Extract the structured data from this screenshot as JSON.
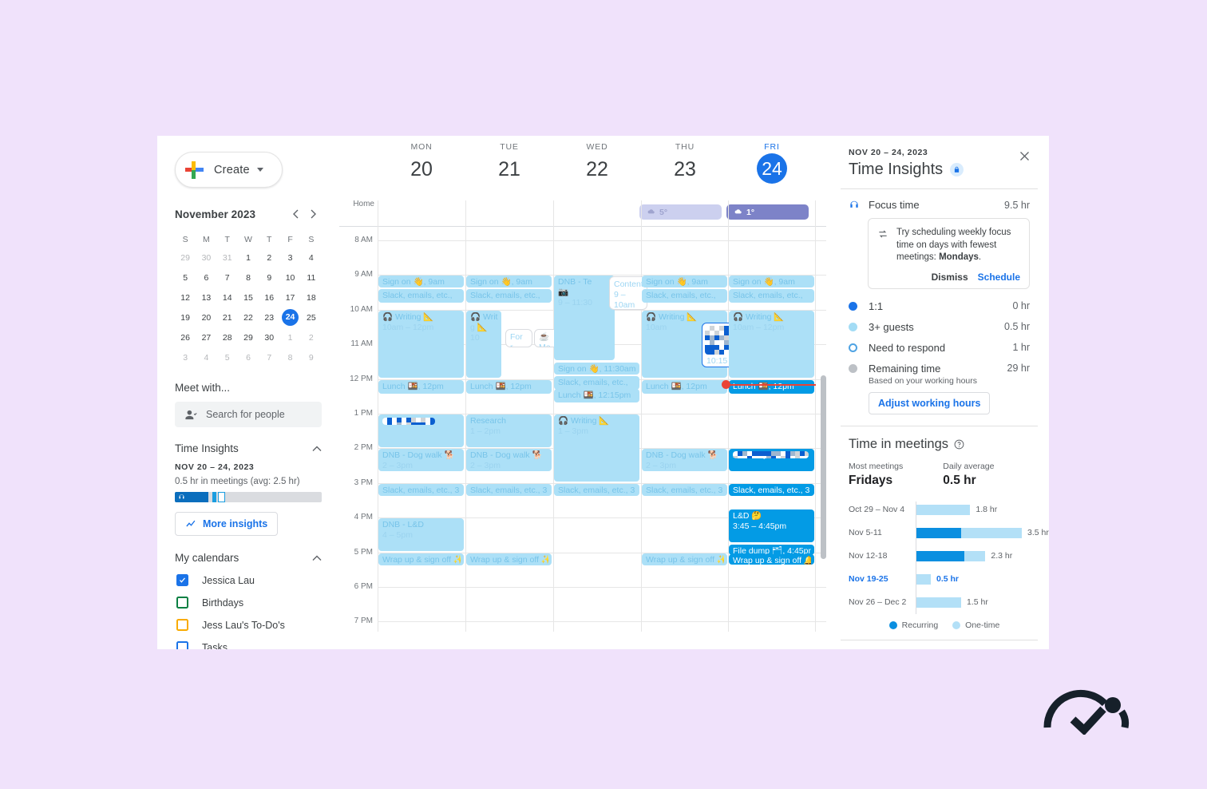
{
  "sidebar": {
    "create_label": "Create",
    "mini_calendar": {
      "title": "November 2023",
      "weekdays": [
        "S",
        "M",
        "T",
        "W",
        "T",
        "F",
        "S"
      ],
      "weeks": [
        [
          {
            "d": "29",
            "m": true
          },
          {
            "d": "30",
            "m": true
          },
          {
            "d": "31",
            "m": true
          },
          {
            "d": "1"
          },
          {
            "d": "2"
          },
          {
            "d": "3"
          },
          {
            "d": "4"
          }
        ],
        [
          {
            "d": "5"
          },
          {
            "d": "6"
          },
          {
            "d": "7"
          },
          {
            "d": "8"
          },
          {
            "d": "9"
          },
          {
            "d": "10"
          },
          {
            "d": "11"
          }
        ],
        [
          {
            "d": "12"
          },
          {
            "d": "13"
          },
          {
            "d": "14"
          },
          {
            "d": "15"
          },
          {
            "d": "16"
          },
          {
            "d": "17"
          },
          {
            "d": "18"
          }
        ],
        [
          {
            "d": "19"
          },
          {
            "d": "20"
          },
          {
            "d": "21"
          },
          {
            "d": "22"
          },
          {
            "d": "23"
          },
          {
            "d": "24",
            "sel": true
          },
          {
            "d": "25"
          }
        ],
        [
          {
            "d": "26"
          },
          {
            "d": "27"
          },
          {
            "d": "28"
          },
          {
            "d": "29"
          },
          {
            "d": "30"
          },
          {
            "d": "1",
            "m": true
          },
          {
            "d": "2",
            "m": true
          }
        ],
        [
          {
            "d": "3",
            "m": true
          },
          {
            "d": "4",
            "m": true
          },
          {
            "d": "5",
            "m": true
          },
          {
            "d": "6",
            "m": true
          },
          {
            "d": "7",
            "m": true
          },
          {
            "d": "8",
            "m": true
          },
          {
            "d": "9",
            "m": true
          }
        ]
      ]
    },
    "meet_with_label": "Meet with...",
    "search_placeholder": "Search for people",
    "time_insights": {
      "heading": "Time Insights",
      "range": "NOV 20 – 24, 2023",
      "summary": "0.5 hr in meetings (avg: 2.5 hr)",
      "more_button": "More insights"
    },
    "my_calendars": {
      "heading": "My calendars",
      "items": [
        {
          "label": "Jessica Lau",
          "checked": true,
          "color": "#1a73e8"
        },
        {
          "label": "Birthdays",
          "checked": false,
          "color": "#0b8043"
        },
        {
          "label": "Jess Lau's To-Do's",
          "checked": false,
          "color": "#f9ab00"
        },
        {
          "label": "Tasks",
          "checked": false,
          "color": "#1a73e8"
        }
      ]
    }
  },
  "calendar": {
    "gutter_top_label": "Home",
    "days": [
      {
        "dow": "MON",
        "num": "20",
        "today": false
      },
      {
        "dow": "TUE",
        "num": "21",
        "today": false
      },
      {
        "dow": "WED",
        "num": "22",
        "today": false
      },
      {
        "dow": "THU",
        "num": "23",
        "today": false
      },
      {
        "dow": "FRI",
        "num": "24",
        "today": true
      }
    ],
    "hours": [
      "8 AM",
      "9 AM",
      "10 AM",
      "11 AM",
      "12 PM",
      "1 PM",
      "2 PM",
      "3 PM",
      "4 PM",
      "5 PM",
      "6 PM",
      "7 PM"
    ],
    "weather": [
      {
        "day": "THU",
        "temp": "5°",
        "style": "light"
      },
      {
        "day": "FRI",
        "temp": "1°",
        "style": "solid"
      }
    ],
    "events": {
      "mon": [
        {
          "l1": "Sign on 👋, 9am",
          "l2": ""
        },
        {
          "l1": "Slack, emails, etc.,",
          "l2": ""
        },
        {
          "l1": "🎧 Writing 📐",
          "l2": "10am – 12pm"
        },
        {
          "l1": "Lunch 🍱, 12pm",
          "l2": ""
        },
        {
          "l1": "",
          "l2": "1 – 2pm"
        },
        {
          "l1": "DNB - Dog walk 🐕",
          "l2": "2 – 3pm"
        },
        {
          "l1": "Slack, emails, etc., 3",
          "l2": ""
        },
        {
          "l1": "DNB - L&D",
          "l2": "4 – 5pm"
        },
        {
          "l1": "Wrap up & sign off ✨",
          "l2": ""
        }
      ],
      "tue": [
        {
          "l1": "Sign on 👋, 9am",
          "l2": ""
        },
        {
          "l1": "Slack, emails, etc.,",
          "l2": ""
        },
        {
          "l1": "🎧 Writin",
          "l2": "g 📐",
          "l3": "10"
        },
        {
          "l1": "Lunch 🍱, 12pm",
          "l2": ""
        },
        {
          "l1": "Research",
          "l2": "1 – 2pm"
        },
        {
          "l1": "DNB - Dog walk 🐕",
          "l2": "2 – 3pm"
        },
        {
          "l1": "Slack, emails, etc., 3",
          "l2": ""
        },
        {
          "l1": "Wrap up & sign off ✨",
          "l2": ""
        }
      ],
      "tue_popups": [
        {
          "l1": "For r"
        },
        {
          "l1": "☕ Me"
        }
      ],
      "wed": [
        {
          "l1": "DNB - Te",
          "l2": "📷",
          "l3": "9 – 11:30"
        },
        {
          "l1": "Sign on 👋, 11:30am",
          "l2": ""
        },
        {
          "l1": "Slack, emails, etc.,",
          "l2": ""
        },
        {
          "l1": "Lunch 🍱, 12:15pm",
          "l2": ""
        },
        {
          "l1": "🎧 Writing 📐",
          "l2": "1 – 3pm"
        },
        {
          "l1": "Slack, emails, etc., 3",
          "l2": ""
        }
      ],
      "wed_popups": [
        {
          "l1": "Content",
          "l2": "9 – 10am"
        }
      ],
      "thu": [
        {
          "l1": "Sign on 👋, 9am",
          "l2": ""
        },
        {
          "l1": "Slack, emails, etc.,",
          "l2": ""
        },
        {
          "l1": "🎧 Writing 📐",
          "l2": "10am"
        },
        {
          "l1": "Lunch 🍱, 12pm",
          "l2": ""
        },
        {
          "l1": "DNB - Dog walk 🐕",
          "l2": "2 – 3pm"
        },
        {
          "l1": "Slack, emails, etc., 3",
          "l2": ""
        },
        {
          "l1": "Wrap up & sign off ✨",
          "l2": ""
        }
      ],
      "thu_popups": [
        {
          "l2": "10:15"
        }
      ],
      "fri": [
        {
          "l1": "Sign on 👋, 9am",
          "l2": ""
        },
        {
          "l1": "Slack, emails, etc.,",
          "l2": ""
        },
        {
          "l1": "🎧 Writing 📐",
          "l2": "10am – 12pm"
        },
        {
          "l1": "Lunch 🍱, 12pm",
          "l2": ""
        },
        {
          "l1": "",
          "l2": "2 – 2:45pm"
        },
        {
          "l1": "Slack, emails, etc., 3",
          "l2": ""
        },
        {
          "l1": "L&D 🤔",
          "l2": "3:45 – 4:45pm"
        },
        {
          "l1": "File dump 🗂, 4:45pm",
          "l2": ""
        },
        {
          "l1": "Wrap up & sign off 🔔",
          "l2": ""
        }
      ]
    }
  },
  "panel": {
    "range": "NOV 20 – 24, 2023",
    "title": "Time Insights",
    "stats": [
      {
        "name": "Focus time",
        "value": "9.5 hr",
        "marker": "headphones"
      },
      {
        "name": "1:1",
        "value": "0 hr",
        "marker": "blue"
      },
      {
        "name": "3+ guests",
        "value": "0.5 hr",
        "marker": "lblue"
      },
      {
        "name": "Need to respond",
        "value": "1 hr",
        "marker": "hollow"
      },
      {
        "name": "Remaining time",
        "value": "29 hr",
        "marker": "gray"
      }
    ],
    "tip": {
      "text_pre": "Try scheduling weekly focus time on days with fewest meetings: ",
      "text_bold": "Mondays",
      "text_post": ".",
      "dismiss": "Dismiss",
      "schedule": "Schedule"
    },
    "remaining_sub": "Based on your working hours",
    "adjust_button": "Adjust working hours",
    "meetings": {
      "heading": "Time in meetings",
      "kpi_most_label": "Most meetings",
      "kpi_most_value": "Fridays",
      "kpi_avg_label": "Daily average",
      "kpi_avg_value": "0.5 hr"
    }
  },
  "chart_data": {
    "type": "bar",
    "title": "Time in meetings",
    "orientation": "horizontal",
    "stacked": true,
    "categories": [
      "Oct 29 – Nov 4",
      "Nov 5-11",
      "Nov 12-18",
      "Nov 19-25",
      "Nov 26 – Dec 2"
    ],
    "series": [
      {
        "name": "Recurring",
        "color": "#0b8fe0",
        "values": [
          0,
          1.5,
          1.6,
          0,
          0
        ]
      },
      {
        "name": "One-time",
        "color": "#b3e0f7",
        "values": [
          1.8,
          2.0,
          0.7,
          0.5,
          1.5
        ]
      }
    ],
    "totals": [
      "1.8 hr",
      "3.5 hr",
      "2.3 hr",
      "0.5 hr",
      "1.5 hr"
    ],
    "highlight_category": "Nov 19-25",
    "legend": [
      "Recurring",
      "One-time"
    ],
    "legend_position": "bottom",
    "xlabel": "",
    "ylabel": "",
    "grid": false
  }
}
